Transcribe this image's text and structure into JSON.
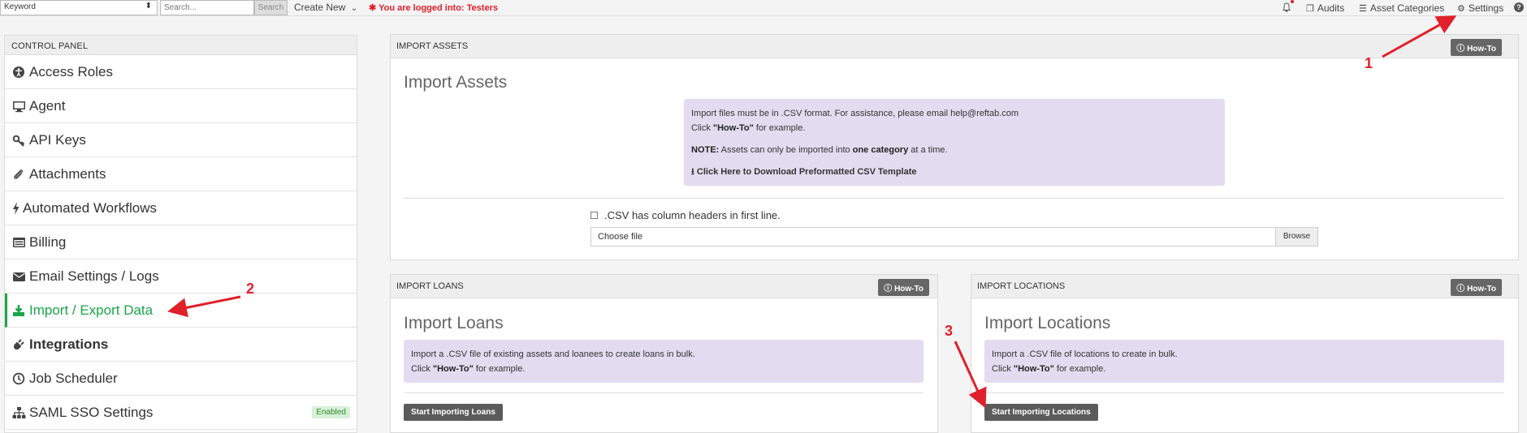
{
  "topbar": {
    "keyword_select": "Keyword",
    "search_placeholder": "Search...",
    "search_button": "Search",
    "create_new": "Create New",
    "logged_in_text": "You are logged into: Testers",
    "audits": "Audits",
    "asset_categories": "Asset Categories",
    "settings": "Settings"
  },
  "sidebar": {
    "header": "CONTROL PANEL",
    "items": [
      {
        "label": "Access Roles",
        "icon": "accessibility-icon"
      },
      {
        "label": "Agent",
        "icon": "monitor-icon"
      },
      {
        "label": "API Keys",
        "icon": "key-icon"
      },
      {
        "label": "Attachments",
        "icon": "paperclip-icon"
      },
      {
        "label": "Automated Workflows",
        "icon": "bolt-icon"
      },
      {
        "label": "Billing",
        "icon": "billing-icon"
      },
      {
        "label": "Email Settings / Logs",
        "icon": "envelope-icon"
      },
      {
        "label": "Import / Export Data",
        "icon": "download-icon",
        "active": true
      },
      {
        "label": "Integrations",
        "icon": "plug-icon"
      },
      {
        "label": "Job Scheduler",
        "icon": "clock-icon"
      },
      {
        "label": "SAML SSO Settings",
        "icon": "sitemap-icon",
        "badge": "Enabled"
      }
    ]
  },
  "import_assets": {
    "header": "IMPORT ASSETS",
    "howto": "How-To",
    "title": "Import Assets",
    "info_line1": "Import files must be in .CSV format. For assistance, please email help@reftab.com",
    "info_click": "Click ",
    "info_howto": "\"How-To\"",
    "info_example": " for example.",
    "note_label": "NOTE:",
    "note_text1": " Assets can only be imported into ",
    "note_bold": "one category",
    "note_text2": " at a time.",
    "download_link": "Click Here to Download Preformatted CSV Template",
    "csv_header_label": ".CSV has column headers in first line.",
    "file_label": "Choose file",
    "browse": "Browse"
  },
  "import_loans": {
    "header": "IMPORT LOANS",
    "howto": "How-To",
    "title": "Import Loans",
    "info_line1": "Import a .CSV file of existing assets and loanees to create loans in bulk.",
    "info_click": "Click ",
    "info_howto": "\"How-To\"",
    "info_example": " for example.",
    "start_button": "Start Importing Loans"
  },
  "import_locations": {
    "header": "IMPORT LOCATIONS",
    "howto": "How-To",
    "title": "Import Locations",
    "info_line1": "Import a .CSV file of locations to create in bulk.",
    "info_click": "Click ",
    "info_howto": "\"How-To\"",
    "info_example": " for example.",
    "start_button": "Start Importing Locations"
  },
  "annotations": [
    "1",
    "2",
    "3"
  ],
  "colors": {
    "accent_green": "#1aa54a",
    "alert_red": "#e0202a",
    "info_purple": "#e3dcf0"
  }
}
